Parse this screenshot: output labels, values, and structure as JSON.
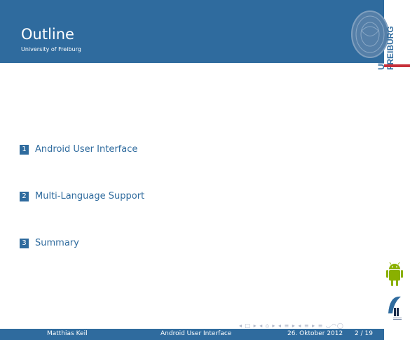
{
  "header": {
    "title": "Outline",
    "subtitle": "University of Freiburg"
  },
  "logo": {
    "line1": "UNI",
    "line2": "FREIBURG"
  },
  "outline": [
    {
      "number": "1",
      "label": "Android User Interface"
    },
    {
      "number": "2",
      "label": "Multi-Language Support"
    },
    {
      "number": "3",
      "label": "Summary"
    }
  ],
  "nav": {
    "symbols": "◂ □ ▸ ◂ ⌂ ▸ ◂ ≡ ▸ ◂ ≡ ▸  ≡  ◡◠◯"
  },
  "footer": {
    "author": "Matthias Keil",
    "title": "Android User Interface",
    "date": "26. Oktober 2012",
    "page": "2 / 19"
  },
  "colors": {
    "theme_blue": "#2f6b9e",
    "accent_red": "#c7303a",
    "android_green": "#8ab000"
  }
}
